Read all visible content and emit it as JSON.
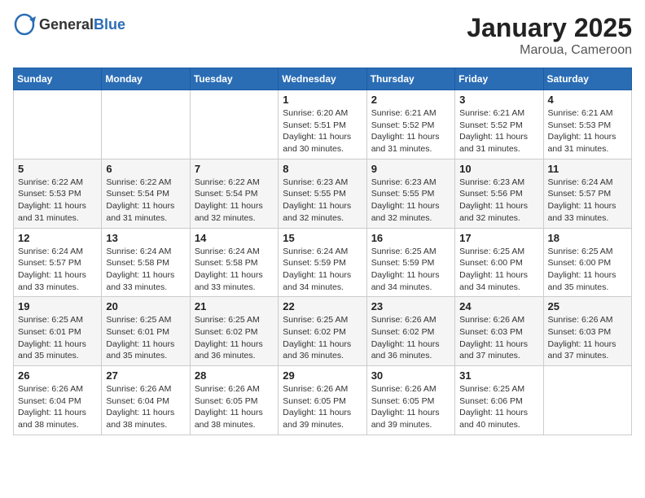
{
  "header": {
    "logo_general": "General",
    "logo_blue": "Blue",
    "month_title": "January 2025",
    "location": "Maroua, Cameroon"
  },
  "weekdays": [
    "Sunday",
    "Monday",
    "Tuesday",
    "Wednesday",
    "Thursday",
    "Friday",
    "Saturday"
  ],
  "weeks": [
    [
      {
        "day": "",
        "info": ""
      },
      {
        "day": "",
        "info": ""
      },
      {
        "day": "",
        "info": ""
      },
      {
        "day": "1",
        "info": "Sunrise: 6:20 AM\nSunset: 5:51 PM\nDaylight: 11 hours\nand 30 minutes."
      },
      {
        "day": "2",
        "info": "Sunrise: 6:21 AM\nSunset: 5:52 PM\nDaylight: 11 hours\nand 31 minutes."
      },
      {
        "day": "3",
        "info": "Sunrise: 6:21 AM\nSunset: 5:52 PM\nDaylight: 11 hours\nand 31 minutes."
      },
      {
        "day": "4",
        "info": "Sunrise: 6:21 AM\nSunset: 5:53 PM\nDaylight: 11 hours\nand 31 minutes."
      }
    ],
    [
      {
        "day": "5",
        "info": "Sunrise: 6:22 AM\nSunset: 5:53 PM\nDaylight: 11 hours\nand 31 minutes."
      },
      {
        "day": "6",
        "info": "Sunrise: 6:22 AM\nSunset: 5:54 PM\nDaylight: 11 hours\nand 31 minutes."
      },
      {
        "day": "7",
        "info": "Sunrise: 6:22 AM\nSunset: 5:54 PM\nDaylight: 11 hours\nand 32 minutes."
      },
      {
        "day": "8",
        "info": "Sunrise: 6:23 AM\nSunset: 5:55 PM\nDaylight: 11 hours\nand 32 minutes."
      },
      {
        "day": "9",
        "info": "Sunrise: 6:23 AM\nSunset: 5:55 PM\nDaylight: 11 hours\nand 32 minutes."
      },
      {
        "day": "10",
        "info": "Sunrise: 6:23 AM\nSunset: 5:56 PM\nDaylight: 11 hours\nand 32 minutes."
      },
      {
        "day": "11",
        "info": "Sunrise: 6:24 AM\nSunset: 5:57 PM\nDaylight: 11 hours\nand 33 minutes."
      }
    ],
    [
      {
        "day": "12",
        "info": "Sunrise: 6:24 AM\nSunset: 5:57 PM\nDaylight: 11 hours\nand 33 minutes."
      },
      {
        "day": "13",
        "info": "Sunrise: 6:24 AM\nSunset: 5:58 PM\nDaylight: 11 hours\nand 33 minutes."
      },
      {
        "day": "14",
        "info": "Sunrise: 6:24 AM\nSunset: 5:58 PM\nDaylight: 11 hours\nand 33 minutes."
      },
      {
        "day": "15",
        "info": "Sunrise: 6:24 AM\nSunset: 5:59 PM\nDaylight: 11 hours\nand 34 minutes."
      },
      {
        "day": "16",
        "info": "Sunrise: 6:25 AM\nSunset: 5:59 PM\nDaylight: 11 hours\nand 34 minutes."
      },
      {
        "day": "17",
        "info": "Sunrise: 6:25 AM\nSunset: 6:00 PM\nDaylight: 11 hours\nand 34 minutes."
      },
      {
        "day": "18",
        "info": "Sunrise: 6:25 AM\nSunset: 6:00 PM\nDaylight: 11 hours\nand 35 minutes."
      }
    ],
    [
      {
        "day": "19",
        "info": "Sunrise: 6:25 AM\nSunset: 6:01 PM\nDaylight: 11 hours\nand 35 minutes."
      },
      {
        "day": "20",
        "info": "Sunrise: 6:25 AM\nSunset: 6:01 PM\nDaylight: 11 hours\nand 35 minutes."
      },
      {
        "day": "21",
        "info": "Sunrise: 6:25 AM\nSunset: 6:02 PM\nDaylight: 11 hours\nand 36 minutes."
      },
      {
        "day": "22",
        "info": "Sunrise: 6:25 AM\nSunset: 6:02 PM\nDaylight: 11 hours\nand 36 minutes."
      },
      {
        "day": "23",
        "info": "Sunrise: 6:26 AM\nSunset: 6:02 PM\nDaylight: 11 hours\nand 36 minutes."
      },
      {
        "day": "24",
        "info": "Sunrise: 6:26 AM\nSunset: 6:03 PM\nDaylight: 11 hours\nand 37 minutes."
      },
      {
        "day": "25",
        "info": "Sunrise: 6:26 AM\nSunset: 6:03 PM\nDaylight: 11 hours\nand 37 minutes."
      }
    ],
    [
      {
        "day": "26",
        "info": "Sunrise: 6:26 AM\nSunset: 6:04 PM\nDaylight: 11 hours\nand 38 minutes."
      },
      {
        "day": "27",
        "info": "Sunrise: 6:26 AM\nSunset: 6:04 PM\nDaylight: 11 hours\nand 38 minutes."
      },
      {
        "day": "28",
        "info": "Sunrise: 6:26 AM\nSunset: 6:05 PM\nDaylight: 11 hours\nand 38 minutes."
      },
      {
        "day": "29",
        "info": "Sunrise: 6:26 AM\nSunset: 6:05 PM\nDaylight: 11 hours\nand 39 minutes."
      },
      {
        "day": "30",
        "info": "Sunrise: 6:26 AM\nSunset: 6:05 PM\nDaylight: 11 hours\nand 39 minutes."
      },
      {
        "day": "31",
        "info": "Sunrise: 6:25 AM\nSunset: 6:06 PM\nDaylight: 11 hours\nand 40 minutes."
      },
      {
        "day": "",
        "info": ""
      }
    ]
  ]
}
